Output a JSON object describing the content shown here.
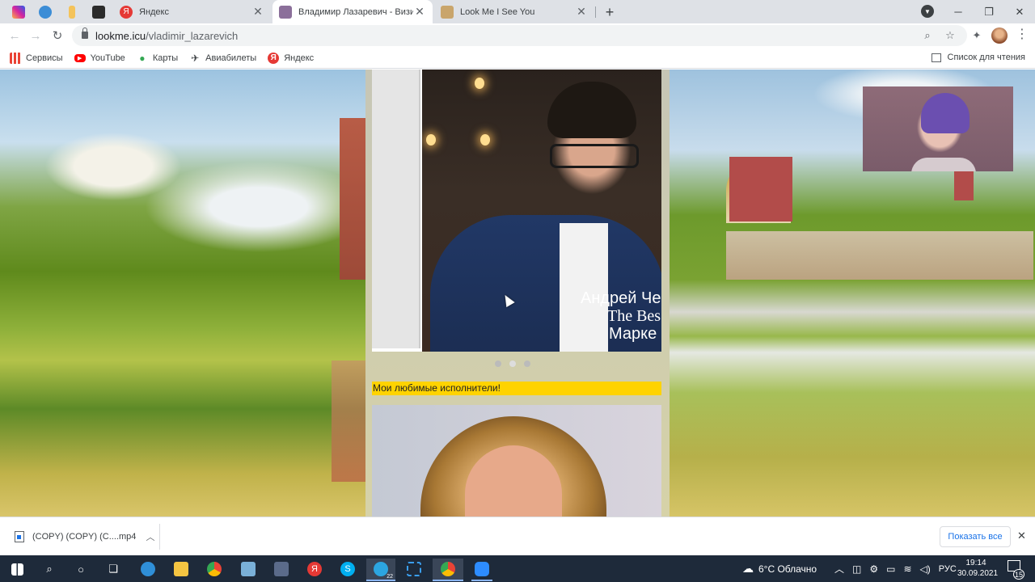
{
  "browser": {
    "tabs": [
      {
        "title": "",
        "favicon": "instagram-icon",
        "color": "#d6249f"
      },
      {
        "title": "",
        "favicon": "globe-icon",
        "color": "#3c8dd6"
      },
      {
        "title": "",
        "favicon": "bookmark-icon",
        "color": "#f4c35b"
      },
      {
        "title": "",
        "favicon": "dark-site-icon",
        "color": "#2b2b2b"
      },
      {
        "title": "Яндекс",
        "favicon": "yandex-icon",
        "color": "#e53935"
      },
      {
        "title": "Владимир Лазаревич - Визитка",
        "favicon": "page-icon",
        "color": "#8b6f9a"
      },
      {
        "title": "Look Me I See You",
        "favicon": "lookme-icon",
        "color": "#c9a56b"
      }
    ],
    "new_tab_label": "+",
    "url_host": "lookme.icu",
    "url_path": "/vladimir_lazarevich",
    "bookmarks": [
      {
        "label": "Сервисы",
        "icon": "apps-grid-icon"
      },
      {
        "label": "YouTube",
        "icon": "youtube-icon"
      },
      {
        "label": "Карты",
        "icon": "maps-pin-icon"
      },
      {
        "label": "Авиабилеты",
        "icon": "plane-icon"
      },
      {
        "label": "Яндекс",
        "icon": "yandex-icon"
      }
    ],
    "reading_list": "Список для чтения"
  },
  "page": {
    "slide_caption": [
      "Андрей Че",
      "The Bes",
      "Марке"
    ],
    "favorites_banner": "Мои любимые исполнители!",
    "carousel_dots": 3,
    "active_dot": 1
  },
  "downloads": {
    "file_name": "(COPY) (COPY) (C....mp4",
    "show_all": "Показать все"
  },
  "taskbar": {
    "weather": "6°C  Облачно",
    "language": "РУС",
    "time": "19:14",
    "date": "30.09.2021",
    "notifications": "15",
    "telegram_badge": "22"
  }
}
